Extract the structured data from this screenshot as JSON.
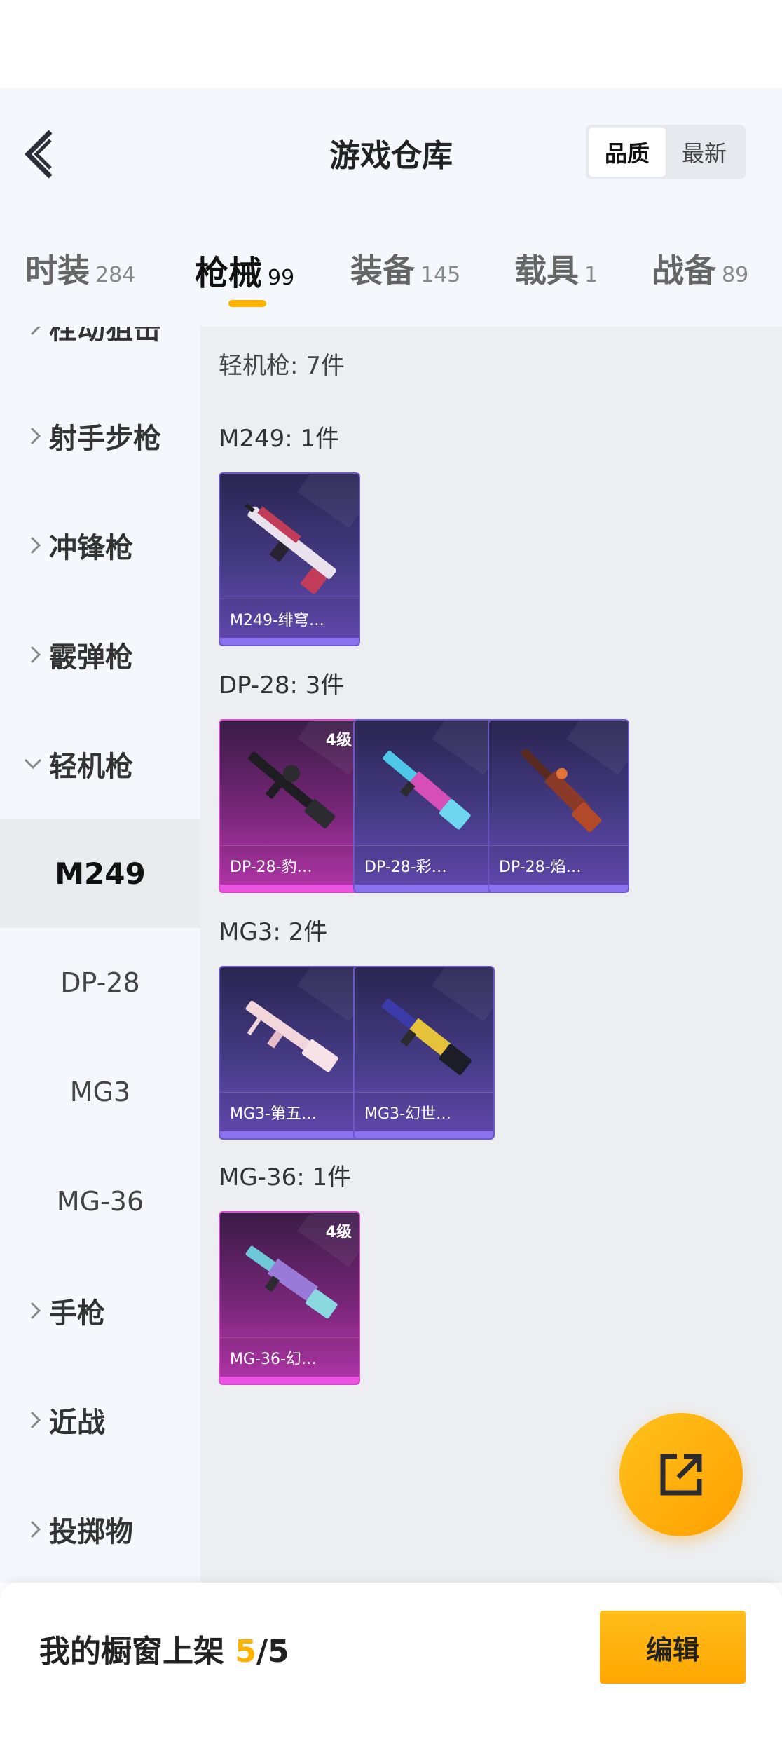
{
  "header": {
    "title": "游戏仓库",
    "sort_options": [
      "品质",
      "最新"
    ],
    "sort_active": "品质"
  },
  "tabs": [
    {
      "label": "时装",
      "count": "284"
    },
    {
      "label": "枪械",
      "count": "99",
      "active": true
    },
    {
      "label": "装备",
      "count": "145"
    },
    {
      "label": "载具",
      "count": "1"
    },
    {
      "label": "战备",
      "count": "89"
    }
  ],
  "sidebar": {
    "partial_top": "栓动狙击",
    "categories": [
      "射手步枪",
      "冲锋枪",
      "霰弹枪",
      "轻机枪",
      "手枪",
      "近战",
      "投掷物"
    ],
    "expanded": "轻机枪",
    "subitems": [
      "M249",
      "DP-28",
      "MG3",
      "MG-36"
    ],
    "active_sub": "M249"
  },
  "content": {
    "summary": "轻机枪: 7件",
    "groups": [
      {
        "title": "M249: 1件",
        "items": [
          {
            "name": "M249-绯穹…",
            "level": "",
            "rarity": "purple"
          }
        ]
      },
      {
        "title": "DP-28: 3件",
        "items": [
          {
            "name": "DP-28-豹…",
            "level": "4级",
            "rarity": "pink"
          },
          {
            "name": "DP-28-彩…",
            "level": "",
            "rarity": "purple"
          },
          {
            "name": "DP-28-焰…",
            "level": "",
            "rarity": "purple"
          }
        ]
      },
      {
        "title": "MG3: 2件",
        "items": [
          {
            "name": "MG3-第五…",
            "level": "",
            "rarity": "purple"
          },
          {
            "name": "MG3-幻世…",
            "level": "",
            "rarity": "purple"
          }
        ]
      },
      {
        "title": "MG-36: 1件",
        "items": [
          {
            "name": "MG-36-幻…",
            "level": "4级",
            "rarity": "pink"
          }
        ]
      }
    ]
  },
  "footer": {
    "label": "我的橱窗上架",
    "current": "5",
    "total": "/5",
    "edit_label": "编辑"
  },
  "icons": {
    "back": "chevron-left-icon",
    "fab": "share-external-icon",
    "accent": "#ffb300"
  }
}
